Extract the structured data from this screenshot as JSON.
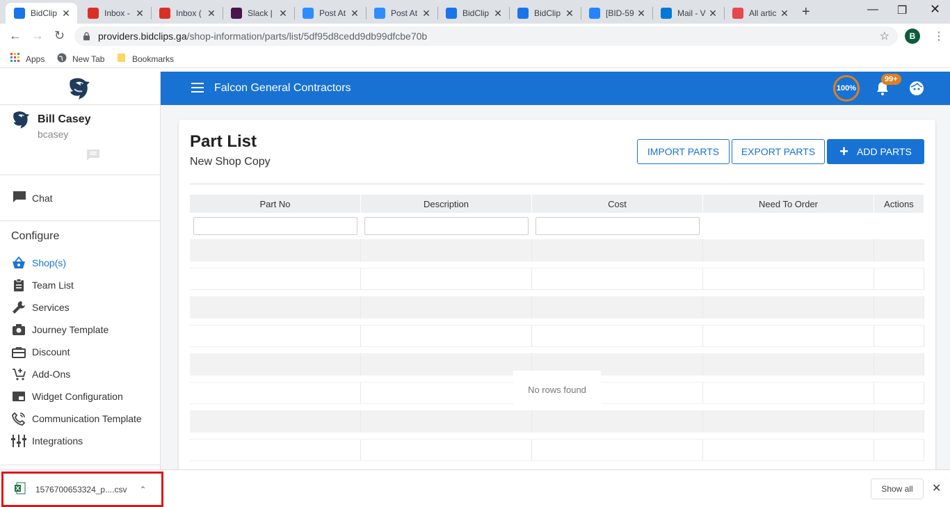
{
  "browser": {
    "tabs": [
      {
        "label": "BidClip",
        "icon": "bidclips-icon",
        "color": "#1a73e8",
        "active": true
      },
      {
        "label": "Inbox -",
        "icon": "gmail-icon",
        "color": "#d93025"
      },
      {
        "label": "Inbox (",
        "icon": "gmail-icon",
        "color": "#d93025"
      },
      {
        "label": "Slack | ",
        "icon": "slack-icon",
        "color": "#4a154b"
      },
      {
        "label": "Post At",
        "icon": "zoom-icon",
        "color": "#2d8cff"
      },
      {
        "label": "Post At",
        "icon": "zoom-icon",
        "color": "#2d8cff"
      },
      {
        "label": "BidClip",
        "icon": "bidclips-icon",
        "color": "#1a73e8"
      },
      {
        "label": "BidClip",
        "icon": "bidclips-icon",
        "color": "#1a73e8"
      },
      {
        "label": "[BID-59",
        "icon": "jira-icon",
        "color": "#2684ff"
      },
      {
        "label": "Mail - V",
        "icon": "outlook-icon",
        "color": "#0078d4"
      },
      {
        "label": "All artic",
        "icon": "article-icon",
        "color": "#e5484d"
      }
    ],
    "url_host": "providers.bidclips.ga",
    "url_path": "/shop-information/parts/list/5df95d8cedd9db99dfcbe70b",
    "profile_initial": "B",
    "bookmarks": [
      {
        "label": "Apps",
        "icon": "apps-grid-icon"
      },
      {
        "label": "New Tab",
        "icon": "globe-icon"
      },
      {
        "label": "Bookmarks",
        "icon": "folder-icon"
      }
    ]
  },
  "sidebar": {
    "user_name": "Bill Casey",
    "user_handle": "bcasey",
    "chat_label": "Chat",
    "configure_title": "Configure",
    "items": [
      {
        "label": "Shop(s)",
        "icon": "basket-icon",
        "active": true
      },
      {
        "label": "Team List",
        "icon": "clipboard-icon"
      },
      {
        "label": "Services",
        "icon": "wrench-icon"
      },
      {
        "label": "Journey Template",
        "icon": "camera-icon"
      },
      {
        "label": "Discount",
        "icon": "gift-card-icon"
      },
      {
        "label": "Add-Ons",
        "icon": "cart-plus-icon"
      },
      {
        "label": "Widget Configuration",
        "icon": "widget-icon"
      },
      {
        "label": "Communication Template",
        "icon": "phone-icon"
      },
      {
        "label": "Integrations",
        "icon": "sliders-icon"
      }
    ]
  },
  "header": {
    "company": "Falcon General Contractors",
    "progress": "100%",
    "notifications": "99+"
  },
  "page": {
    "title": "Part List",
    "subtitle": "New Shop Copy",
    "import_label": "IMPORT PARTS",
    "export_label": "EXPORT PARTS",
    "add_label": "ADD PARTS"
  },
  "grid": {
    "columns": [
      "Part No",
      "Description",
      "Cost",
      "Need To Order",
      "Actions"
    ],
    "empty_text": "No rows found"
  },
  "downloads": {
    "file_name": "1576700653324_p....csv",
    "show_all": "Show all"
  }
}
